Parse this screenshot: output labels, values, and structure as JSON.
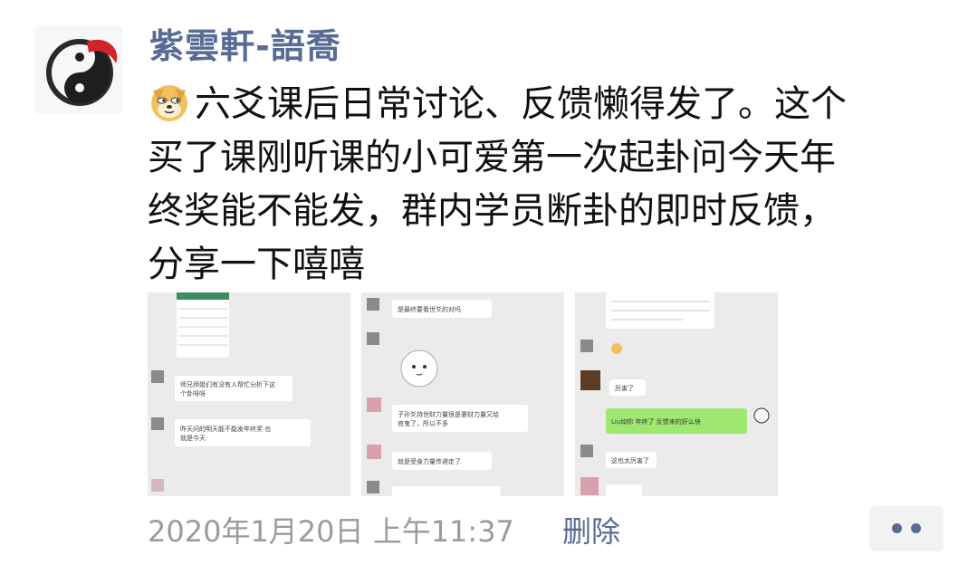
{
  "post": {
    "author": "紫雲軒-語喬",
    "avatar_icon": "ink-yin-yang-avatar",
    "emoji_icon": "doge-emoji",
    "content_lines": [
      "六爻课后日常讨论、反馈懒得发了。这个",
      "买了课刚听课的小可爱第一次起卦问今天年",
      "终奖能不能发，群内学员断卦的即时反馈，",
      "分享一下嘻嘻"
    ],
    "timestamp": "2020年1月20日 上午11:37",
    "delete_label": "删除",
    "more_icon": "more-dots-icon"
  },
  "images": [
    {
      "name": "chat-screenshot-1",
      "messages": [
        "师兄师姐们有没有人帮忙分析下这个卦呀呀",
        "昨天问的明天能不能发年终奖 也就是今天"
      ]
    },
    {
      "name": "chat-screenshot-2",
      "messages": [
        "是最终要看世爻的对吗",
        "子孙爻持世财力量很是妻财力量又给官鬼了，所以不多",
        "就是受身力量传递走了"
      ]
    },
    {
      "name": "chat-screenshot-3",
      "messages": [
        "厉害了",
        "Liu如你 年终了 反馈来的好么快",
        "这也太厉害了"
      ]
    }
  ]
}
